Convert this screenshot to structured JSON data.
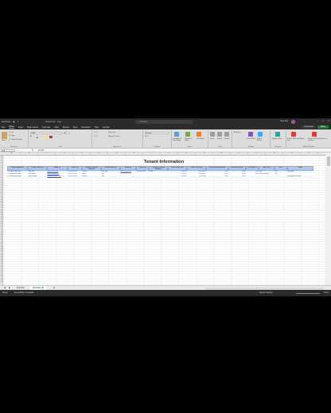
{
  "titlebar": {
    "autosave": "AutoSave",
    "filename": "Tenant Info · Log ~",
    "search_placeholder": "Search",
    "user": "Jane Doe"
  },
  "menu": [
    "File",
    "Home",
    "Insert",
    "Page Layout",
    "Formulas",
    "Data",
    "Review",
    "View",
    "Developer",
    "Help",
    "Acrobat"
  ],
  "menu_active": "Home",
  "comments_label": "Comments",
  "share_label": "Share",
  "ribbon_groups": [
    "Clipboard",
    "Font",
    "Alignment",
    "Number",
    "Styles",
    "Cells",
    "Editing",
    "Analysis",
    "Adobe Acrobat"
  ],
  "ribbon_items": {
    "paste": "Paste",
    "wrap": "Wrap Text",
    "merge": "Merge & Center",
    "number_format": "General",
    "cond_format": "Conditional Formatting",
    "format_table": "Format as Table",
    "cell_styles": "Cell Styles",
    "insert": "Insert",
    "delete": "Delete",
    "format": "Format",
    "autosum": "AutoSum",
    "sort": "Sort & Filter",
    "find": "Find & Select",
    "analyze": "Analyze Data",
    "create_pdf": "Create PDF and Share link",
    "share_pdf": "Create PDF and Share via Outlook"
  },
  "formula_bar": {
    "cell": "A7",
    "fx": "fx",
    "value": "Go 3/7"
  },
  "columns": [
    "A",
    "B",
    "C",
    "D",
    "E",
    "F",
    "G",
    "H",
    "I",
    "J",
    "K",
    "L",
    "M",
    "N",
    "O",
    "P",
    "Q",
    "R"
  ],
  "sheet_title": "Tenant Information",
  "headers": [
    "Property Address",
    "Tenant Name (1)",
    "Email (1)",
    "Phone (1)",
    "Preferred Contact Method",
    "Tenant Name (2)",
    "Email (2)",
    "Phone (2)",
    "Preferred Contact Method",
    "Lease Start Date",
    "Lease End Date",
    "Monthly Rent Amount",
    "Security Deposit",
    "Pet Deposit",
    "Type of Pet",
    "Pets?",
    "Notes"
  ],
  "rows": [
    [
      "123 Main Street, Apt 1",
      "John Doe",
      "jdoe@email.com",
      "555-555-5555",
      "Phone",
      "Jane Doe",
      "jane@email.com",
      "555-555-5556",
      "Email",
      "1/1/2023",
      "12/31/2023",
      "1,200",
      "1,200",
      "500",
      "Dog",
      "Yes",
      "Renewed"
    ],
    [
      "123 Main Street, Apt 2",
      "Jane Smith",
      "jsmith@email.com",
      "555-555-5557",
      "Email",
      "N/A",
      "",
      "",
      "",
      "1/1/2023",
      "12/31/2023",
      "1,200",
      "1,200",
      "300",
      "Dog - Retriever",
      "Yes",
      ""
    ],
    [
      "123 Main Street, Apt 3",
      "Bob Johnson",
      "bjohnson@email.com",
      "555-555-5558",
      "Phone",
      "N/A",
      "",
      "",
      "",
      "2/1/2023",
      "1/31/2024",
      "1,200",
      "1,200",
      "",
      "",
      "",
      "Late payments noted"
    ]
  ],
  "sheet_tabs": [
    "Example",
    "Example (2)"
  ],
  "active_tab": "Example (2)",
  "status": {
    "ready": "Ready",
    "accessibility": "Accessibility: Investigate",
    "display": "Display Settings",
    "zoom": "100%"
  }
}
